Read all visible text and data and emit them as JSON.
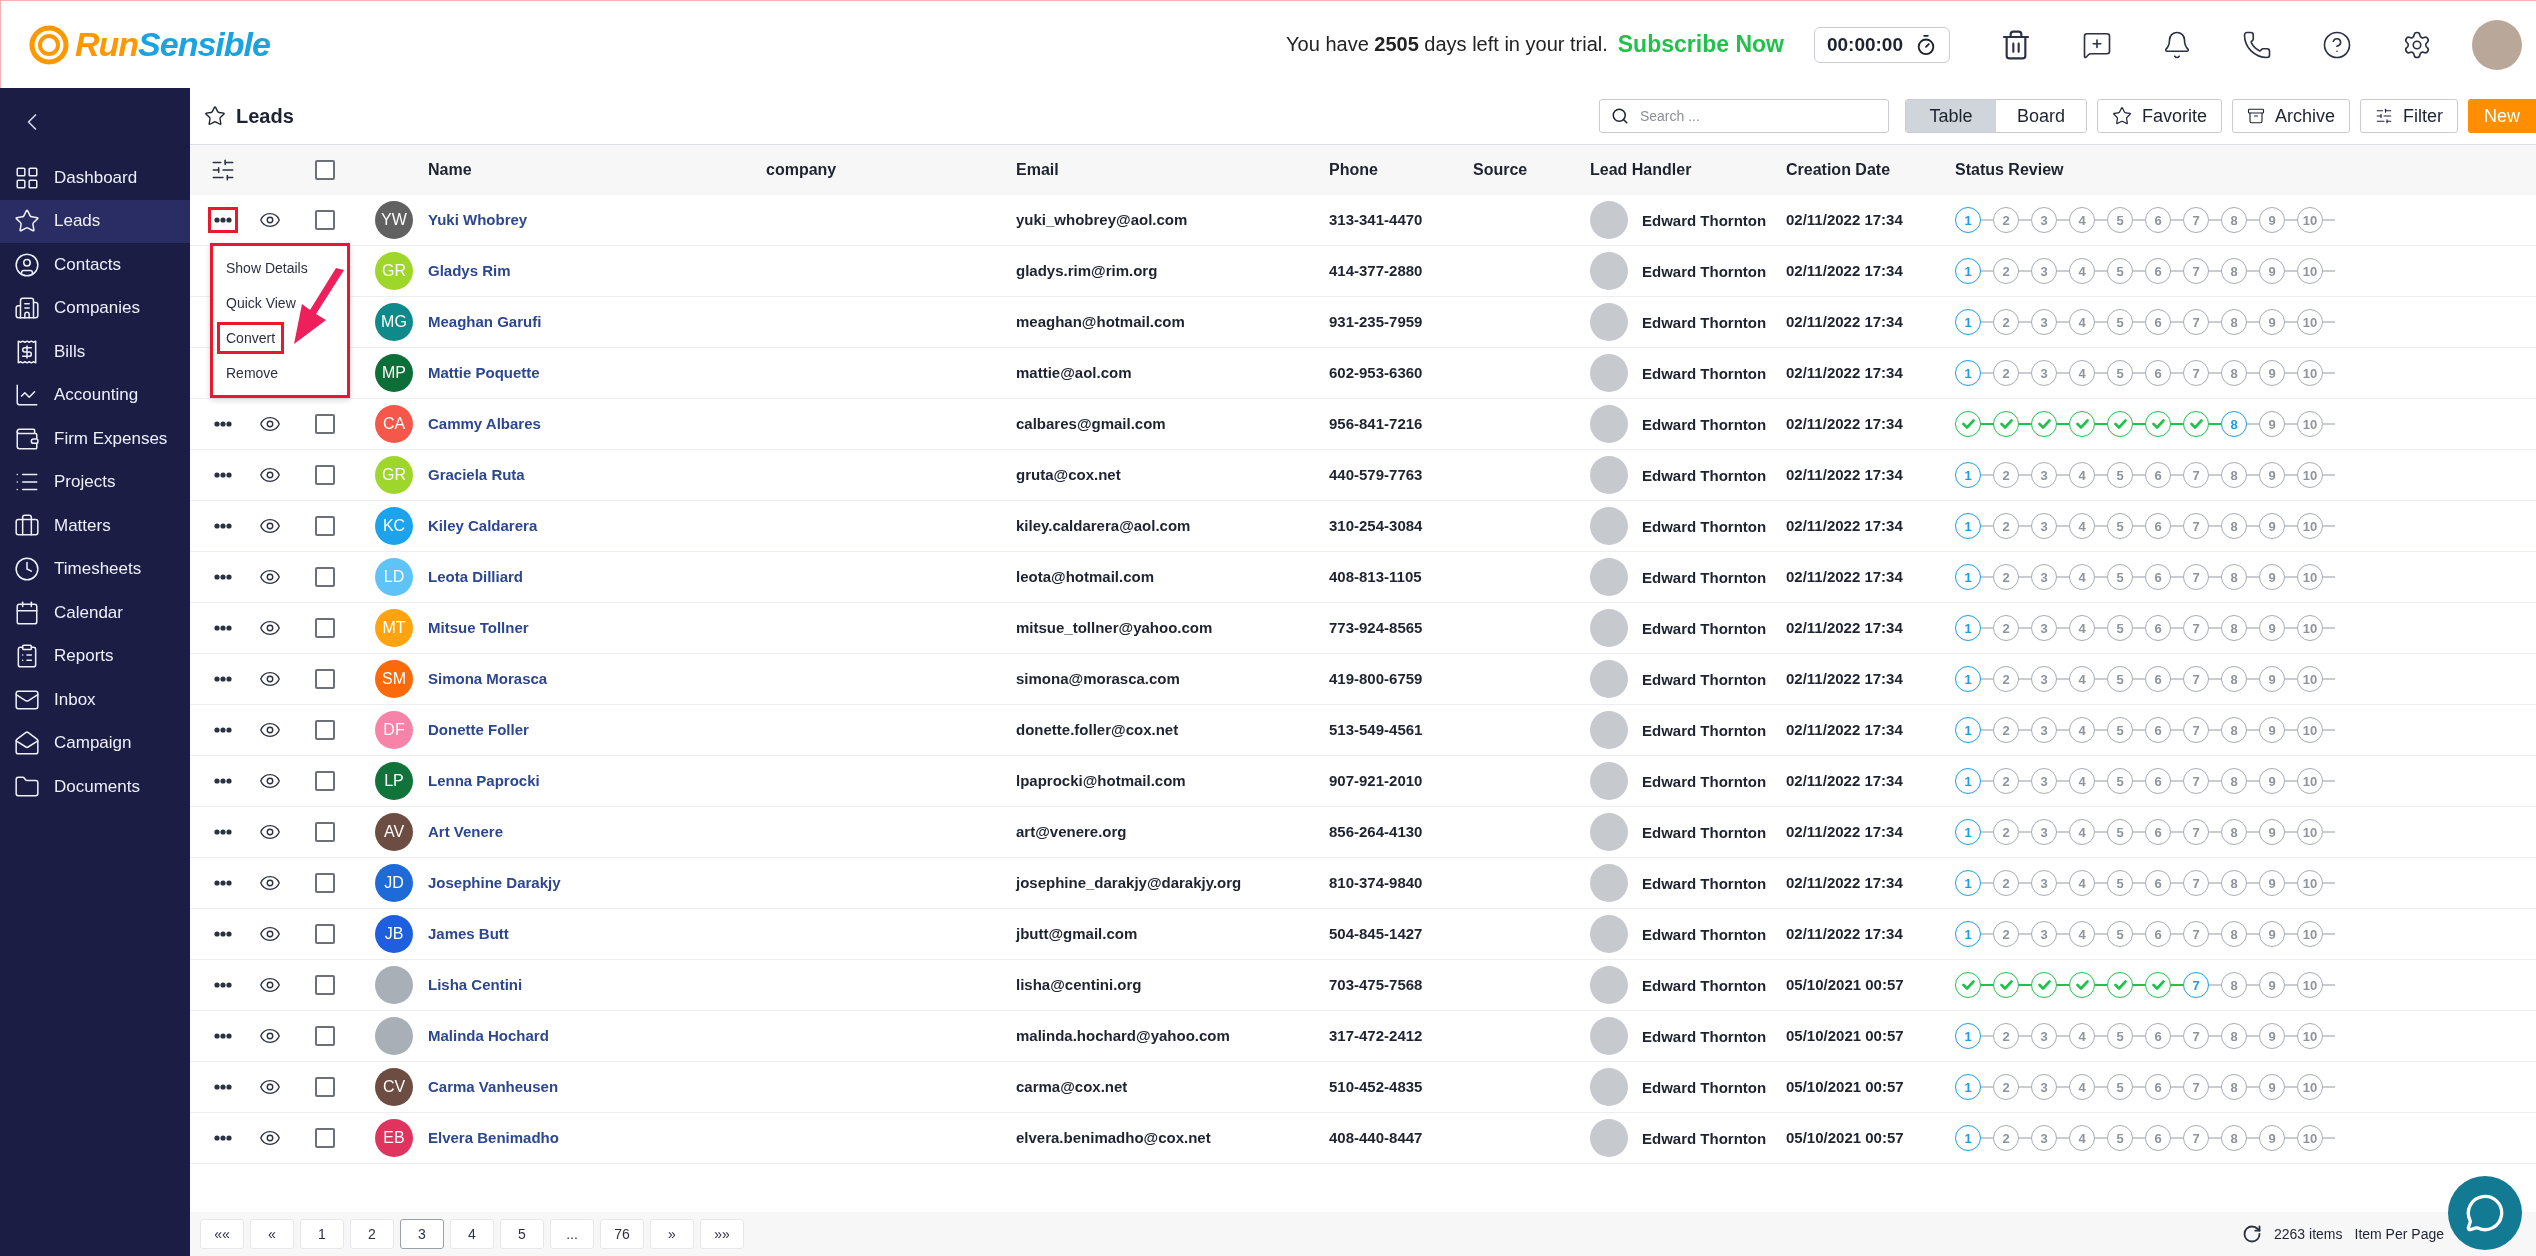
{
  "header": {
    "logo": {
      "first": "Run",
      "second": "Sensible"
    },
    "trial_text": "You have **2505** days left in your trial.",
    "subscribe_link": "Subscribe Now",
    "timer": "00:00:00"
  },
  "sidebar": {
    "items": [
      {
        "label": "Dashboard",
        "selected": false
      },
      {
        "label": "Leads",
        "selected": true
      },
      {
        "label": "Contacts",
        "selected": false
      },
      {
        "label": "Companies",
        "selected": false
      },
      {
        "label": "Bills",
        "selected": false
      },
      {
        "label": "Accounting",
        "selected": false
      },
      {
        "label": "Firm Expenses",
        "selected": false
      },
      {
        "label": "Projects",
        "selected": false
      },
      {
        "label": "Matters",
        "selected": false
      },
      {
        "label": "Timesheets",
        "selected": false
      },
      {
        "label": "Calendar",
        "selected": false
      },
      {
        "label": "Reports",
        "selected": false
      },
      {
        "label": "Inbox",
        "selected": false
      },
      {
        "label": "Campaign",
        "selected": false
      },
      {
        "label": "Documents",
        "selected": false
      }
    ]
  },
  "toolbar": {
    "title": "Leads",
    "search": {
      "placeholder": "Search ..."
    },
    "views": [
      {
        "label": "Table",
        "selected": true
      },
      {
        "label": "Board",
        "selected": false
      }
    ],
    "favorite": "Favorite",
    "archive": "Archive",
    "filter": "Filter",
    "new": "New"
  },
  "action_menu": {
    "items": [
      {
        "label": "Show Details",
        "highlighted": false
      },
      {
        "label": "Quick View",
        "highlighted": false
      },
      {
        "label": "Convert",
        "highlighted": true
      },
      {
        "label": "Remove",
        "highlighted": false
      }
    ]
  },
  "table": {
    "select_all_checked": false,
    "columns": [
      "Name",
      "company",
      "Email",
      "Phone",
      "Source",
      "Lead Handler",
      "Creation Date",
      "Status Review"
    ],
    "rows": [
      {
        "menu_open": true,
        "checked": false,
        "avatar": {
          "kind": "initials",
          "initials": "YW",
          "color": "#616161"
        },
        "name": "Yuki Whobrey",
        "email": "yuki_whobrey@aol.com",
        "phone": "313-341-4470",
        "handler": "Edward Thornton",
        "created": "02/11/2022 17:34",
        "status_steps": [
          {
            "done": false,
            "current": true,
            "label": "1"
          },
          {
            "done": false,
            "current": false,
            "label": "2"
          },
          {
            "done": false,
            "current": false,
            "label": "3"
          },
          {
            "done": false,
            "current": false,
            "label": "4"
          },
          {
            "done": false,
            "current": false,
            "label": "5"
          },
          {
            "done": false,
            "current": false,
            "label": "6"
          },
          {
            "done": false,
            "current": false,
            "label": "7"
          },
          {
            "done": false,
            "current": false,
            "label": "8"
          },
          {
            "done": false,
            "current": false,
            "label": "9"
          },
          {
            "done": false,
            "current": false,
            "label": "10"
          }
        ]
      },
      {
        "menu_open": false,
        "avatar": {
          "kind": "initials",
          "initials": "GR",
          "color": "#9ed62b"
        },
        "name": "Gladys Rim",
        "email": "gladys.rim@rim.org",
        "phone": "414-377-2880",
        "handler": "Edward Thornton",
        "created": "02/11/2022 17:34",
        "status_steps": [
          {
            "done": false,
            "current": true,
            "label": "1"
          },
          {
            "done": false,
            "current": false,
            "label": "2"
          },
          {
            "done": false,
            "current": false,
            "label": "3"
          },
          {
            "done": false,
            "current": false,
            "label": "4"
          },
          {
            "done": false,
            "current": false,
            "label": "5"
          },
          {
            "done": false,
            "current": false,
            "label": "6"
          },
          {
            "done": false,
            "current": false,
            "label": "7"
          },
          {
            "done": false,
            "current": false,
            "label": "8"
          },
          {
            "done": false,
            "current": false,
            "label": "9"
          },
          {
            "done": false,
            "current": false,
            "label": "10"
          }
        ]
      },
      {
        "menu_open": false,
        "avatar": {
          "kind": "initials",
          "initials": "MG",
          "color": "#0f8a8a"
        },
        "name": "Meaghan Garufi",
        "email": "meaghan@hotmail.com",
        "phone": "931-235-7959",
        "handler": "Edward Thornton",
        "created": "02/11/2022 17:34",
        "status_steps": [
          {
            "done": false,
            "current": true,
            "label": "1"
          },
          {
            "done": false,
            "current": false,
            "label": "2"
          },
          {
            "done": false,
            "current": false,
            "label": "3"
          },
          {
            "done": false,
            "current": false,
            "label": "4"
          },
          {
            "done": false,
            "current": false,
            "label": "5"
          },
          {
            "done": false,
            "current": false,
            "label": "6"
          },
          {
            "done": false,
            "current": false,
            "label": "7"
          },
          {
            "done": false,
            "current": false,
            "label": "8"
          },
          {
            "done": false,
            "current": false,
            "label": "9"
          },
          {
            "done": false,
            "current": false,
            "label": "10"
          }
        ]
      },
      {
        "menu_open": false,
        "avatar": {
          "kind": "initials",
          "initials": "MP",
          "color": "#0e6e37"
        },
        "name": "Mattie Poquette",
        "email": "mattie@aol.com",
        "phone": "602-953-6360",
        "handler": "Edward Thornton",
        "created": "02/11/2022 17:34",
        "status_steps": [
          {
            "done": false,
            "current": true,
            "label": "1"
          },
          {
            "done": false,
            "current": false,
            "label": "2"
          },
          {
            "done": false,
            "current": false,
            "label": "3"
          },
          {
            "done": false,
            "current": false,
            "label": "4"
          },
          {
            "done": false,
            "current": false,
            "label": "5"
          },
          {
            "done": false,
            "current": false,
            "label": "6"
          },
          {
            "done": false,
            "current": false,
            "label": "7"
          },
          {
            "done": false,
            "current": false,
            "label": "8"
          },
          {
            "done": false,
            "current": false,
            "label": "9"
          },
          {
            "done": false,
            "current": false,
            "label": "10"
          }
        ]
      },
      {
        "menu_open": false,
        "checked": false,
        "avatar": {
          "kind": "initials",
          "initials": "CA",
          "color": "#f5584b"
        },
        "name": "Cammy Albares",
        "email": "calbares@gmail.com",
        "phone": "956-841-7216",
        "handler": "Edward Thornton",
        "created": "02/11/2022 17:34",
        "status_steps": [
          {
            "done": true,
            "current": false
          },
          {
            "done": true,
            "current": false
          },
          {
            "done": true,
            "current": false
          },
          {
            "done": true,
            "current": false
          },
          {
            "done": true,
            "current": false
          },
          {
            "done": true,
            "current": false
          },
          {
            "done": true,
            "current": false
          },
          {
            "done": false,
            "current": true,
            "label": "8"
          },
          {
            "done": false,
            "current": false,
            "label": "9"
          },
          {
            "done": false,
            "current": false,
            "label": "10"
          }
        ]
      },
      {
        "menu_open": false,
        "checked": false,
        "avatar": {
          "kind": "initials",
          "initials": "GR",
          "color": "#9ed62b"
        },
        "name": "Graciela Ruta",
        "email": "gruta@cox.net",
        "phone": "440-579-7763",
        "handler": "Edward Thornton",
        "created": "02/11/2022 17:34",
        "status_steps": [
          {
            "done": false,
            "current": true,
            "label": "1"
          },
          {
            "done": false,
            "current": false,
            "label": "2"
          },
          {
            "done": false,
            "current": false,
            "label": "3"
          },
          {
            "done": false,
            "current": false,
            "label": "4"
          },
          {
            "done": false,
            "current": false,
            "label": "5"
          },
          {
            "done": false,
            "current": false,
            "label": "6"
          },
          {
            "done": false,
            "current": false,
            "label": "7"
          },
          {
            "done": false,
            "current": false,
            "label": "8"
          },
          {
            "done": false,
            "current": false,
            "label": "9"
          },
          {
            "done": false,
            "current": false,
            "label": "10"
          }
        ]
      },
      {
        "menu_open": false,
        "checked": false,
        "avatar": {
          "kind": "initials",
          "initials": "KC",
          "color": "#1ca3ec"
        },
        "name": "Kiley Caldarera",
        "email": "kiley.caldarera@aol.com",
        "phone": "310-254-3084",
        "handler": "Edward Thornton",
        "created": "02/11/2022 17:34",
        "status_steps": [
          {
            "done": false,
            "current": true,
            "label": "1"
          },
          {
            "done": false,
            "current": false,
            "label": "2"
          },
          {
            "done": false,
            "current": false,
            "label": "3"
          },
          {
            "done": false,
            "current": false,
            "label": "4"
          },
          {
            "done": false,
            "current": false,
            "label": "5"
          },
          {
            "done": false,
            "current": false,
            "label": "6"
          },
          {
            "done": false,
            "current": false,
            "label": "7"
          },
          {
            "done": false,
            "current": false,
            "label": "8"
          },
          {
            "done": false,
            "current": false,
            "label": "9"
          },
          {
            "done": false,
            "current": false,
            "label": "10"
          }
        ]
      },
      {
        "menu_open": false,
        "checked": false,
        "avatar": {
          "kind": "initials",
          "initials": "LD",
          "color": "#5ec3f7"
        },
        "name": "Leota Dilliard",
        "email": "leota@hotmail.com",
        "phone": "408-813-1105",
        "handler": "Edward Thornton",
        "created": "02/11/2022 17:34",
        "status_steps": [
          {
            "done": false,
            "current": true,
            "label": "1"
          },
          {
            "done": false,
            "current": false,
            "label": "2"
          },
          {
            "done": false,
            "current": false,
            "label": "3"
          },
          {
            "done": false,
            "current": false,
            "label": "4"
          },
          {
            "done": false,
            "current": false,
            "label": "5"
          },
          {
            "done": false,
            "current": false,
            "label": "6"
          },
          {
            "done": false,
            "current": false,
            "label": "7"
          },
          {
            "done": false,
            "current": false,
            "label": "8"
          },
          {
            "done": false,
            "current": false,
            "label": "9"
          },
          {
            "done": false,
            "current": false,
            "label": "10"
          }
        ]
      },
      {
        "menu_open": false,
        "checked": false,
        "avatar": {
          "kind": "initials",
          "initials": "MT",
          "color": "#ffa40f"
        },
        "name": "Mitsue Tollner",
        "email": "mitsue_tollner@yahoo.com",
        "phone": "773-924-8565",
        "handler": "Edward Thornton",
        "created": "02/11/2022 17:34",
        "status_steps": [
          {
            "done": false,
            "current": true,
            "label": "1"
          },
          {
            "done": false,
            "current": false,
            "label": "2"
          },
          {
            "done": false,
            "current": false,
            "label": "3"
          },
          {
            "done": false,
            "current": false,
            "label": "4"
          },
          {
            "done": false,
            "current": false,
            "label": "5"
          },
          {
            "done": false,
            "current": false,
            "label": "6"
          },
          {
            "done": false,
            "current": false,
            "label": "7"
          },
          {
            "done": false,
            "current": false,
            "label": "8"
          },
          {
            "done": false,
            "current": false,
            "label": "9"
          },
          {
            "done": false,
            "current": false,
            "label": "10"
          }
        ]
      },
      {
        "menu_open": false,
        "checked": false,
        "avatar": {
          "kind": "initials",
          "initials": "SM",
          "color": "#fa6a0a"
        },
        "name": "Simona Morasca",
        "email": "simona@morasca.com",
        "phone": "419-800-6759",
        "handler": "Edward Thornton",
        "created": "02/11/2022 17:34",
        "status_steps": [
          {
            "done": false,
            "current": true,
            "label": "1"
          },
          {
            "done": false,
            "current": false,
            "label": "2"
          },
          {
            "done": false,
            "current": false,
            "label": "3"
          },
          {
            "done": false,
            "current": false,
            "label": "4"
          },
          {
            "done": false,
            "current": false,
            "label": "5"
          },
          {
            "done": false,
            "current": false,
            "label": "6"
          },
          {
            "done": false,
            "current": false,
            "label": "7"
          },
          {
            "done": false,
            "current": false,
            "label": "8"
          },
          {
            "done": false,
            "current": false,
            "label": "9"
          },
          {
            "done": false,
            "current": false,
            "label": "10"
          }
        ]
      },
      {
        "menu_open": false,
        "checked": false,
        "avatar": {
          "kind": "initials",
          "initials": "DF",
          "color": "#f783a9"
        },
        "name": "Donette Foller",
        "email": "donette.foller@cox.net",
        "phone": "513-549-4561",
        "handler": "Edward Thornton",
        "created": "02/11/2022 17:34",
        "status_steps": [
          {
            "done": false,
            "current": true,
            "label": "1"
          },
          {
            "done": false,
            "current": false,
            "label": "2"
          },
          {
            "done": false,
            "current": false,
            "label": "3"
          },
          {
            "done": false,
            "current": false,
            "label": "4"
          },
          {
            "done": false,
            "current": false,
            "label": "5"
          },
          {
            "done": false,
            "current": false,
            "label": "6"
          },
          {
            "done": false,
            "current": false,
            "label": "7"
          },
          {
            "done": false,
            "current": false,
            "label": "8"
          },
          {
            "done": false,
            "current": false,
            "label": "9"
          },
          {
            "done": false,
            "current": false,
            "label": "10"
          }
        ]
      },
      {
        "menu_open": false,
        "checked": false,
        "avatar": {
          "kind": "initials",
          "initials": "LP",
          "color": "#12733a"
        },
        "name": "Lenna Paprocki",
        "email": "lpaprocki@hotmail.com",
        "phone": "907-921-2010",
        "handler": "Edward Thornton",
        "created": "02/11/2022 17:34",
        "status_steps": [
          {
            "done": false,
            "current": true,
            "label": "1"
          },
          {
            "done": false,
            "current": false,
            "label": "2"
          },
          {
            "done": false,
            "current": false,
            "label": "3"
          },
          {
            "done": false,
            "current": false,
            "label": "4"
          },
          {
            "done": false,
            "current": false,
            "label": "5"
          },
          {
            "done": false,
            "current": false,
            "label": "6"
          },
          {
            "done": false,
            "current": false,
            "label": "7"
          },
          {
            "done": false,
            "current": false,
            "label": "8"
          },
          {
            "done": false,
            "current": false,
            "label": "9"
          },
          {
            "done": false,
            "current": false,
            "label": "10"
          }
        ]
      },
      {
        "menu_open": false,
        "checked": false,
        "avatar": {
          "kind": "initials",
          "initials": "AV",
          "color": "#6d4c41"
        },
        "name": "Art Venere",
        "email": "art@venere.org",
        "phone": "856-264-4130",
        "handler": "Edward Thornton",
        "created": "02/11/2022 17:34",
        "status_steps": [
          {
            "done": false,
            "current": true,
            "label": "1"
          },
          {
            "done": false,
            "current": false,
            "label": "2"
          },
          {
            "done": false,
            "current": false,
            "label": "3"
          },
          {
            "done": false,
            "current": false,
            "label": "4"
          },
          {
            "done": false,
            "current": false,
            "label": "5"
          },
          {
            "done": false,
            "current": false,
            "label": "6"
          },
          {
            "done": false,
            "current": false,
            "label": "7"
          },
          {
            "done": false,
            "current": false,
            "label": "8"
          },
          {
            "done": false,
            "current": false,
            "label": "9"
          },
          {
            "done": false,
            "current": false,
            "label": "10"
          }
        ]
      },
      {
        "menu_open": false,
        "checked": false,
        "avatar": {
          "kind": "initials",
          "initials": "JD",
          "color": "#1e6ad8"
        },
        "name": "Josephine Darakjy",
        "email": "josephine_darakjy@darakjy.org",
        "phone": "810-374-9840",
        "handler": "Edward Thornton",
        "created": "02/11/2022 17:34",
        "status_steps": [
          {
            "done": false,
            "current": true,
            "label": "1"
          },
          {
            "done": false,
            "current": false,
            "label": "2"
          },
          {
            "done": false,
            "current": false,
            "label": "3"
          },
          {
            "done": false,
            "current": false,
            "label": "4"
          },
          {
            "done": false,
            "current": false,
            "label": "5"
          },
          {
            "done": false,
            "current": false,
            "label": "6"
          },
          {
            "done": false,
            "current": false,
            "label": "7"
          },
          {
            "done": false,
            "current": false,
            "label": "8"
          },
          {
            "done": false,
            "current": false,
            "label": "9"
          },
          {
            "done": false,
            "current": false,
            "label": "10"
          }
        ]
      },
      {
        "menu_open": false,
        "checked": false,
        "avatar": {
          "kind": "initials",
          "initials": "JB",
          "color": "#1e5fe0"
        },
        "name": "James Butt",
        "email": "jbutt@gmail.com",
        "phone": "504-845-1427",
        "handler": "Edward Thornton",
        "created": "02/11/2022 17:34",
        "status_steps": [
          {
            "done": false,
            "current": true,
            "label": "1"
          },
          {
            "done": false,
            "current": false,
            "label": "2"
          },
          {
            "done": false,
            "current": false,
            "label": "3"
          },
          {
            "done": false,
            "current": false,
            "label": "4"
          },
          {
            "done": false,
            "current": false,
            "label": "5"
          },
          {
            "done": false,
            "current": false,
            "label": "6"
          },
          {
            "done": false,
            "current": false,
            "label": "7"
          },
          {
            "done": false,
            "current": false,
            "label": "8"
          },
          {
            "done": false,
            "current": false,
            "label": "9"
          },
          {
            "done": false,
            "current": false,
            "label": "10"
          }
        ]
      },
      {
        "menu_open": false,
        "checked": false,
        "avatar": {
          "kind": "photo"
        },
        "name": "Lisha Centini",
        "email": "lisha@centini.org",
        "phone": "703-475-7568",
        "handler": "Edward Thornton",
        "created": "05/10/2021 00:57",
        "status_steps": [
          {
            "done": true,
            "current": false
          },
          {
            "done": true,
            "current": false
          },
          {
            "done": true,
            "current": false
          },
          {
            "done": true,
            "current": false
          },
          {
            "done": true,
            "current": false
          },
          {
            "done": true,
            "current": false
          },
          {
            "done": false,
            "current": true,
            "label": "7"
          },
          {
            "done": false,
            "current": false,
            "label": "8"
          },
          {
            "done": false,
            "current": false,
            "label": "9"
          },
          {
            "done": false,
            "current": false,
            "label": "10"
          }
        ]
      },
      {
        "menu_open": false,
        "checked": false,
        "avatar": {
          "kind": "photo"
        },
        "name": "Malinda Hochard",
        "email": "malinda.hochard@yahoo.com",
        "phone": "317-472-2412",
        "handler": "Edward Thornton",
        "created": "05/10/2021 00:57",
        "status_steps": [
          {
            "done": false,
            "current": true,
            "label": "1"
          },
          {
            "done": false,
            "current": false,
            "label": "2"
          },
          {
            "done": false,
            "current": false,
            "label": "3"
          },
          {
            "done": false,
            "current": false,
            "label": "4"
          },
          {
            "done": false,
            "current": false,
            "label": "5"
          },
          {
            "done": false,
            "current": false,
            "label": "6"
          },
          {
            "done": false,
            "current": false,
            "label": "7"
          },
          {
            "done": false,
            "current": false,
            "label": "8"
          },
          {
            "done": false,
            "current": false,
            "label": "9"
          },
          {
            "done": false,
            "current": false,
            "label": "10"
          }
        ]
      },
      {
        "menu_open": false,
        "checked": false,
        "avatar": {
          "kind": "initials",
          "initials": "CV",
          "color": "#6d4c41"
        },
        "name": "Carma Vanheusen",
        "email": "carma@cox.net",
        "phone": "510-452-4835",
        "handler": "Edward Thornton",
        "created": "05/10/2021 00:57",
        "status_steps": [
          {
            "done": false,
            "current": true,
            "label": "1"
          },
          {
            "done": false,
            "current": false,
            "label": "2"
          },
          {
            "done": false,
            "current": false,
            "label": "3"
          },
          {
            "done": false,
            "current": false,
            "label": "4"
          },
          {
            "done": false,
            "current": false,
            "label": "5"
          },
          {
            "done": false,
            "current": false,
            "label": "6"
          },
          {
            "done": false,
            "current": false,
            "label": "7"
          },
          {
            "done": false,
            "current": false,
            "label": "8"
          },
          {
            "done": false,
            "current": false,
            "label": "9"
          },
          {
            "done": false,
            "current": false,
            "label": "10"
          }
        ]
      },
      {
        "menu_open": false,
        "checked": false,
        "avatar": {
          "kind": "initials",
          "initials": "EB",
          "color": "#e0335e"
        },
        "name": "Elvera Benimadho",
        "email": "elvera.benimadho@cox.net",
        "phone": "408-440-8447",
        "handler": "Edward Thornton",
        "created": "05/10/2021 00:57",
        "status_steps": [
          {
            "done": false,
            "current": true,
            "label": "1"
          },
          {
            "done": false,
            "current": false,
            "label": "2"
          },
          {
            "done": false,
            "current": false,
            "label": "3"
          },
          {
            "done": false,
            "current": false,
            "label": "4"
          },
          {
            "done": false,
            "current": false,
            "label": "5"
          },
          {
            "done": false,
            "current": false,
            "label": "6"
          },
          {
            "done": false,
            "current": false,
            "label": "7"
          },
          {
            "done": false,
            "current": false,
            "label": "8"
          },
          {
            "done": false,
            "current": false,
            "label": "9"
          },
          {
            "done": false,
            "current": false,
            "label": "10"
          }
        ]
      }
    ]
  },
  "pagination": {
    "pages": [
      {
        "label": "««",
        "selected": false
      },
      {
        "label": "«",
        "selected": false
      },
      {
        "label": "1",
        "selected": false
      },
      {
        "label": "2",
        "selected": false
      },
      {
        "label": "3",
        "selected": true
      },
      {
        "label": "4",
        "selected": false
      },
      {
        "label": "5",
        "selected": false
      },
      {
        "label": "...",
        "selected": false
      },
      {
        "label": "76",
        "selected": false
      },
      {
        "label": "»",
        "selected": false
      },
      {
        "label": "»»",
        "selected": false
      }
    ],
    "count": "2263 items",
    "per_page_label": "Item Per Page"
  }
}
